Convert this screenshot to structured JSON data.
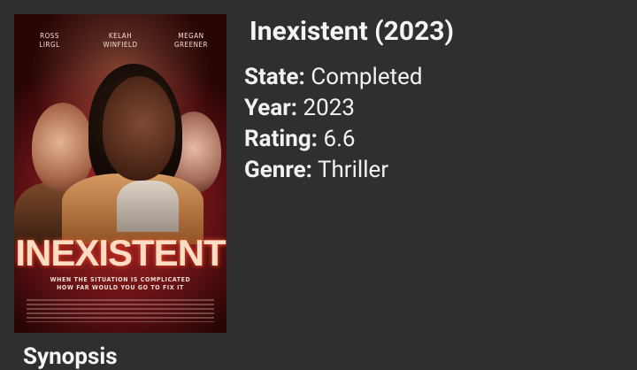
{
  "poster": {
    "cast": [
      "ROSS\nLIRGL",
      "KELAH\nWINFIELD",
      "MEGAN\nGREENER"
    ],
    "title": "INEXISTENT",
    "tagline": "WHEN THE SITUATION IS COMPLICATED\nHOW FAR WOULD YOU GO TO FIX IT"
  },
  "title": "Inexistent (2023)",
  "details": [
    {
      "key": "State:",
      "value": "Completed"
    },
    {
      "key": "Year:",
      "value": "2023"
    },
    {
      "key": "Rating:",
      "value": "6.6"
    },
    {
      "key": "Genre:",
      "value": "Thriller"
    }
  ],
  "synopsis_heading": "Synopsis"
}
